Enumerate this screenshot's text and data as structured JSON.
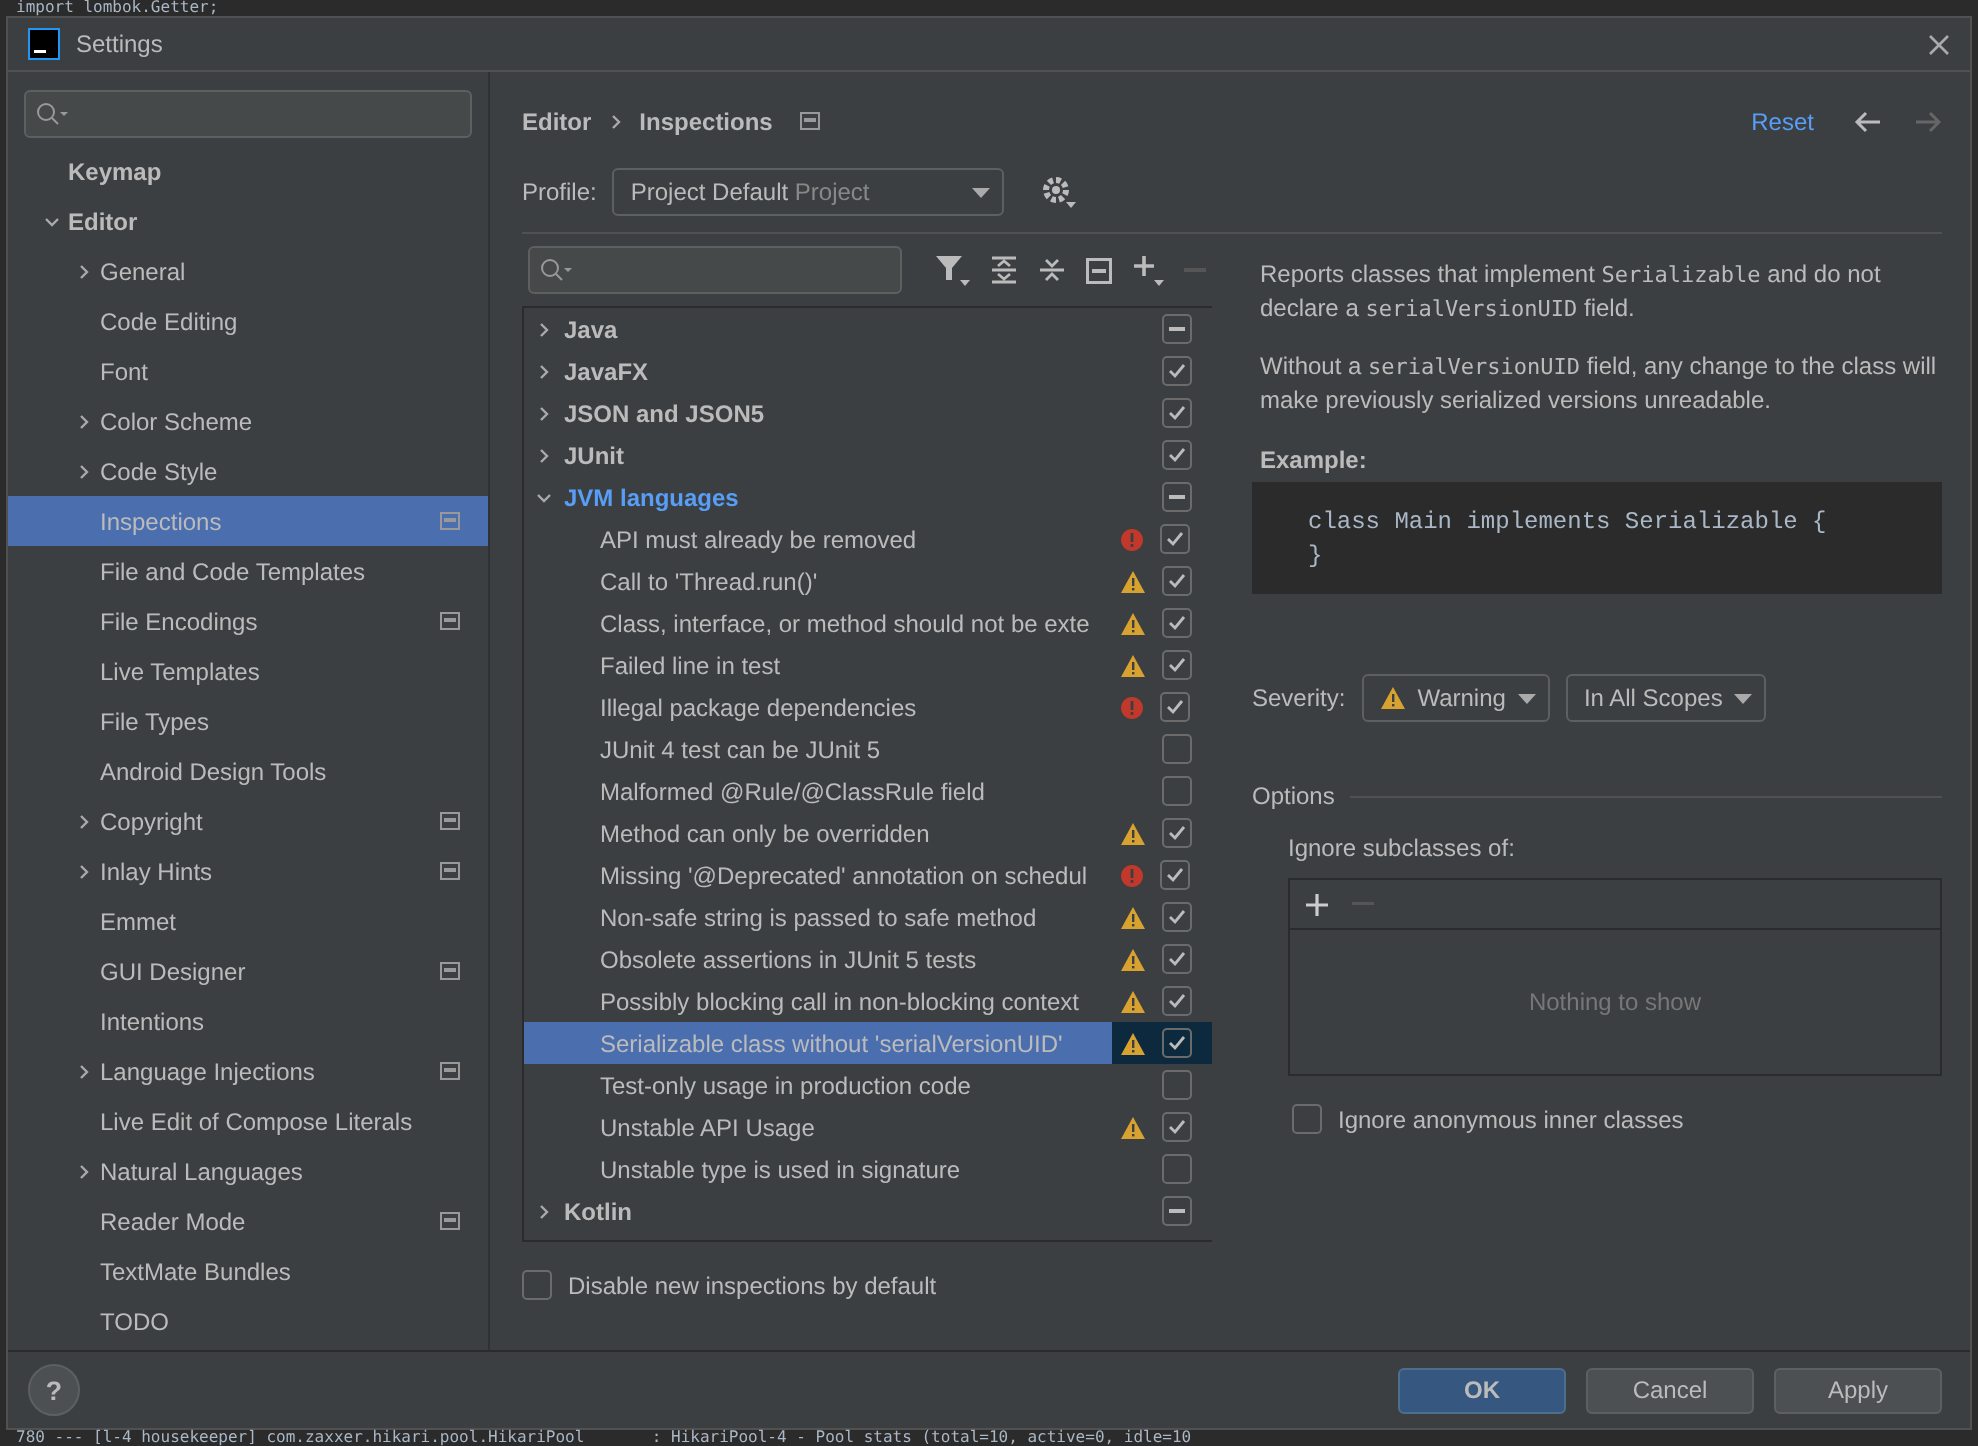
{
  "background_editor": {
    "top_line": "import lombok.Getter;",
    "bottom_line": "780 --- [l-4 housekeeper] com.zaxxer.hikari.pool.HikariPool       : HikariPool-4 - Pool stats (total=10, active=0, idle=10"
  },
  "window": {
    "title": "Settings"
  },
  "sidebar": {
    "items": [
      {
        "label": "Keymap",
        "expandable": false,
        "selected": false,
        "badge": false
      },
      {
        "label": "Editor",
        "expandable": true,
        "expanded": true,
        "selected": false,
        "badge": false,
        "children": [
          {
            "label": "General",
            "expandable": true,
            "expanded": false,
            "selected": false,
            "badge": false
          },
          {
            "label": "Code Editing",
            "expandable": false,
            "selected": false,
            "badge": false
          },
          {
            "label": "Font",
            "expandable": false,
            "selected": false,
            "badge": false
          },
          {
            "label": "Color Scheme",
            "expandable": true,
            "expanded": false,
            "selected": false,
            "badge": false
          },
          {
            "label": "Code Style",
            "expandable": true,
            "expanded": false,
            "selected": false,
            "badge": false
          },
          {
            "label": "Inspections",
            "expandable": false,
            "selected": true,
            "badge": true
          },
          {
            "label": "File and Code Templates",
            "expandable": false,
            "selected": false,
            "badge": false
          },
          {
            "label": "File Encodings",
            "expandable": false,
            "selected": false,
            "badge": true
          },
          {
            "label": "Live Templates",
            "expandable": false,
            "selected": false,
            "badge": false
          },
          {
            "label": "File Types",
            "expandable": false,
            "selected": false,
            "badge": false
          },
          {
            "label": "Android Design Tools",
            "expandable": false,
            "selected": false,
            "badge": false
          },
          {
            "label": "Copyright",
            "expandable": true,
            "expanded": false,
            "selected": false,
            "badge": true
          },
          {
            "label": "Inlay Hints",
            "expandable": true,
            "expanded": false,
            "selected": false,
            "badge": true
          },
          {
            "label": "Emmet",
            "expandable": false,
            "selected": false,
            "badge": false
          },
          {
            "label": "GUI Designer",
            "expandable": false,
            "selected": false,
            "badge": true
          },
          {
            "label": "Intentions",
            "expandable": false,
            "selected": false,
            "badge": false
          },
          {
            "label": "Language Injections",
            "expandable": true,
            "expanded": false,
            "selected": false,
            "badge": true
          },
          {
            "label": "Live Edit of Compose Literals",
            "expandable": false,
            "selected": false,
            "badge": false
          },
          {
            "label": "Natural Languages",
            "expandable": true,
            "expanded": false,
            "selected": false,
            "badge": false
          },
          {
            "label": "Reader Mode",
            "expandable": false,
            "selected": false,
            "badge": true
          },
          {
            "label": "TextMate Bundles",
            "expandable": false,
            "selected": false,
            "badge": false
          },
          {
            "label": "TODO",
            "expandable": false,
            "selected": false,
            "badge": false
          }
        ]
      }
    ]
  },
  "breadcrumb": [
    "Editor",
    "Inspections"
  ],
  "reset": "Reset",
  "profile": {
    "label": "Profile:",
    "value": "Project Default",
    "scope": "Project"
  },
  "tree": [
    {
      "label": "Java",
      "expanded": false,
      "checked": false,
      "partial": true
    },
    {
      "label": "JavaFX",
      "expanded": false,
      "checked": true
    },
    {
      "label": "JSON and JSON5",
      "expanded": false,
      "checked": true
    },
    {
      "label": "JUnit",
      "expanded": false,
      "checked": true
    },
    {
      "label": "JVM languages",
      "expanded": true,
      "checked": false,
      "partial": true,
      "children": [
        {
          "label": "API must already be removed",
          "kind": "error",
          "checked": true,
          "selected": false
        },
        {
          "label": "Call to 'Thread.run()'",
          "kind": "warning",
          "checked": true,
          "selected": false
        },
        {
          "label": "Class, interface, or method should not be exte",
          "kind": "warning",
          "checked": true,
          "selected": false
        },
        {
          "label": "Failed line in test",
          "kind": "warning",
          "checked": true,
          "selected": false
        },
        {
          "label": "Illegal package dependencies",
          "kind": "error",
          "checked": true,
          "selected": false
        },
        {
          "label": "JUnit 4 test can be JUnit 5",
          "kind": "plain",
          "checked": false,
          "selected": false
        },
        {
          "label": "Malformed @Rule/@ClassRule field",
          "kind": "plain",
          "checked": false,
          "selected": false
        },
        {
          "label": "Method can only be overridden",
          "kind": "warning",
          "checked": true,
          "selected": false
        },
        {
          "label": "Missing '@Deprecated' annotation on schedul",
          "kind": "error",
          "checked": true,
          "selected": false
        },
        {
          "label": "Non-safe string is passed to safe method",
          "kind": "warning",
          "checked": true,
          "selected": false
        },
        {
          "label": "Obsolete assertions in JUnit 5 tests",
          "kind": "warning",
          "checked": true,
          "selected": false
        },
        {
          "label": "Possibly blocking call in non-blocking context",
          "kind": "warning",
          "checked": true,
          "selected": false
        },
        {
          "label": "Serializable class without 'serialVersionUID'",
          "kind": "warning",
          "checked": true,
          "selected": true
        },
        {
          "label": "Test-only usage in production code",
          "kind": "plain",
          "checked": false,
          "selected": false
        },
        {
          "label": "Unstable API Usage",
          "kind": "warning",
          "checked": true,
          "selected": false
        },
        {
          "label": "Unstable type is used in signature",
          "kind": "plain",
          "checked": false,
          "selected": false
        }
      ]
    },
    {
      "label": "Kotlin",
      "expanded": false,
      "checked": false,
      "partial": true
    }
  ],
  "disable_new": {
    "label": "Disable new inspections by default",
    "checked": false
  },
  "description": {
    "paragraphs": [
      [
        {
          "text": "Reports classes that implement ",
          "code": false
        },
        {
          "text": "Serializable",
          "code": true
        },
        {
          "text": " and do not declare a ",
          "code": false
        },
        {
          "text": "serialVersionUID",
          "code": true
        },
        {
          "text": " field.",
          "code": false
        }
      ],
      [
        {
          "text": "Without a ",
          "code": false
        },
        {
          "text": "serialVersionUID",
          "code": true
        },
        {
          "text": " field, any change to the class will make previously serialized versions unreadable.",
          "code": false
        }
      ]
    ],
    "example_heading": "Example:",
    "code": [
      "class Main implements Serializable {",
      "}"
    ]
  },
  "severity": {
    "label": "Severity:",
    "value": "Warning",
    "scope": "In All Scopes"
  },
  "options": {
    "heading": "Options",
    "list_label": "Ignore subclasses of:",
    "empty_text": "Nothing to show",
    "ignore_anonymous": {
      "label": "Ignore anonymous inner classes",
      "checked": false
    }
  },
  "help": "?",
  "buttons": [
    {
      "label": "OK",
      "primary": true
    },
    {
      "label": "Cancel",
      "primary": false
    },
    {
      "label": "Apply",
      "primary": false
    }
  ]
}
